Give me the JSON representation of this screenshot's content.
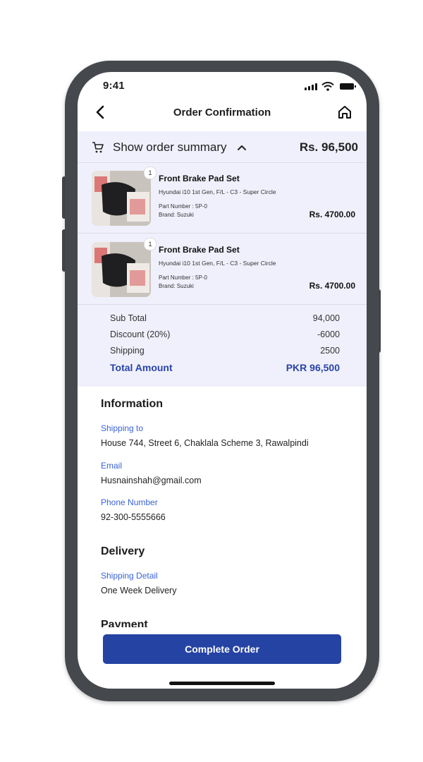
{
  "status_bar": {
    "time": "9:41"
  },
  "header": {
    "title": "Order Confirmation",
    "back_icon": "chevron-left-icon",
    "home_icon": "home-icon"
  },
  "summary_bar": {
    "label": "Show order summary",
    "total": "Rs. 96,500"
  },
  "items": [
    {
      "qty": "1",
      "name": "Front Brake Pad Set",
      "vehicle": "Hyundai i10 1st Gen, F/L - C3 - Super Circle",
      "part": "Part Number : 5P-0",
      "brand": "Brand: Suzuki",
      "price": "Rs. 4700.00"
    },
    {
      "qty": "1",
      "name": "Front Brake Pad Set",
      "vehicle": "Hyundai i10 1st Gen, F/L - C3 - Super Circle",
      "part": "Part Number : 5P-0",
      "brand": "Brand: Suzuki",
      "price": "Rs. 4700.00"
    }
  ],
  "totals": {
    "subtotal_label": "Sub Total",
    "subtotal": "94,000",
    "discount_label": "Discount (20%)",
    "discount": "-6000",
    "shipping_label": "Shipping",
    "shipping": "2500",
    "total_label": "Total Amount",
    "total": "PKR 96,500"
  },
  "information": {
    "title": "Information",
    "shipping_label": "Shipping to",
    "shipping_value": "House 744, Street 6, Chaklala Scheme 3, Rawalpindi",
    "email_label": "Email",
    "email_value": "Husnainshah@gmail.com",
    "phone_label": "Phone Number",
    "phone_value": "92-300-5555666"
  },
  "delivery": {
    "title": "Delivery",
    "detail_label": "Shipping Detail",
    "detail_value": "One Week Delivery"
  },
  "payment": {
    "title": "Payment"
  },
  "cta": {
    "label": "Complete Order"
  },
  "colors": {
    "accent": "#2543a3",
    "link": "#3b63d6",
    "summary_bg": "#eff0fb",
    "frame": "#45484d"
  }
}
